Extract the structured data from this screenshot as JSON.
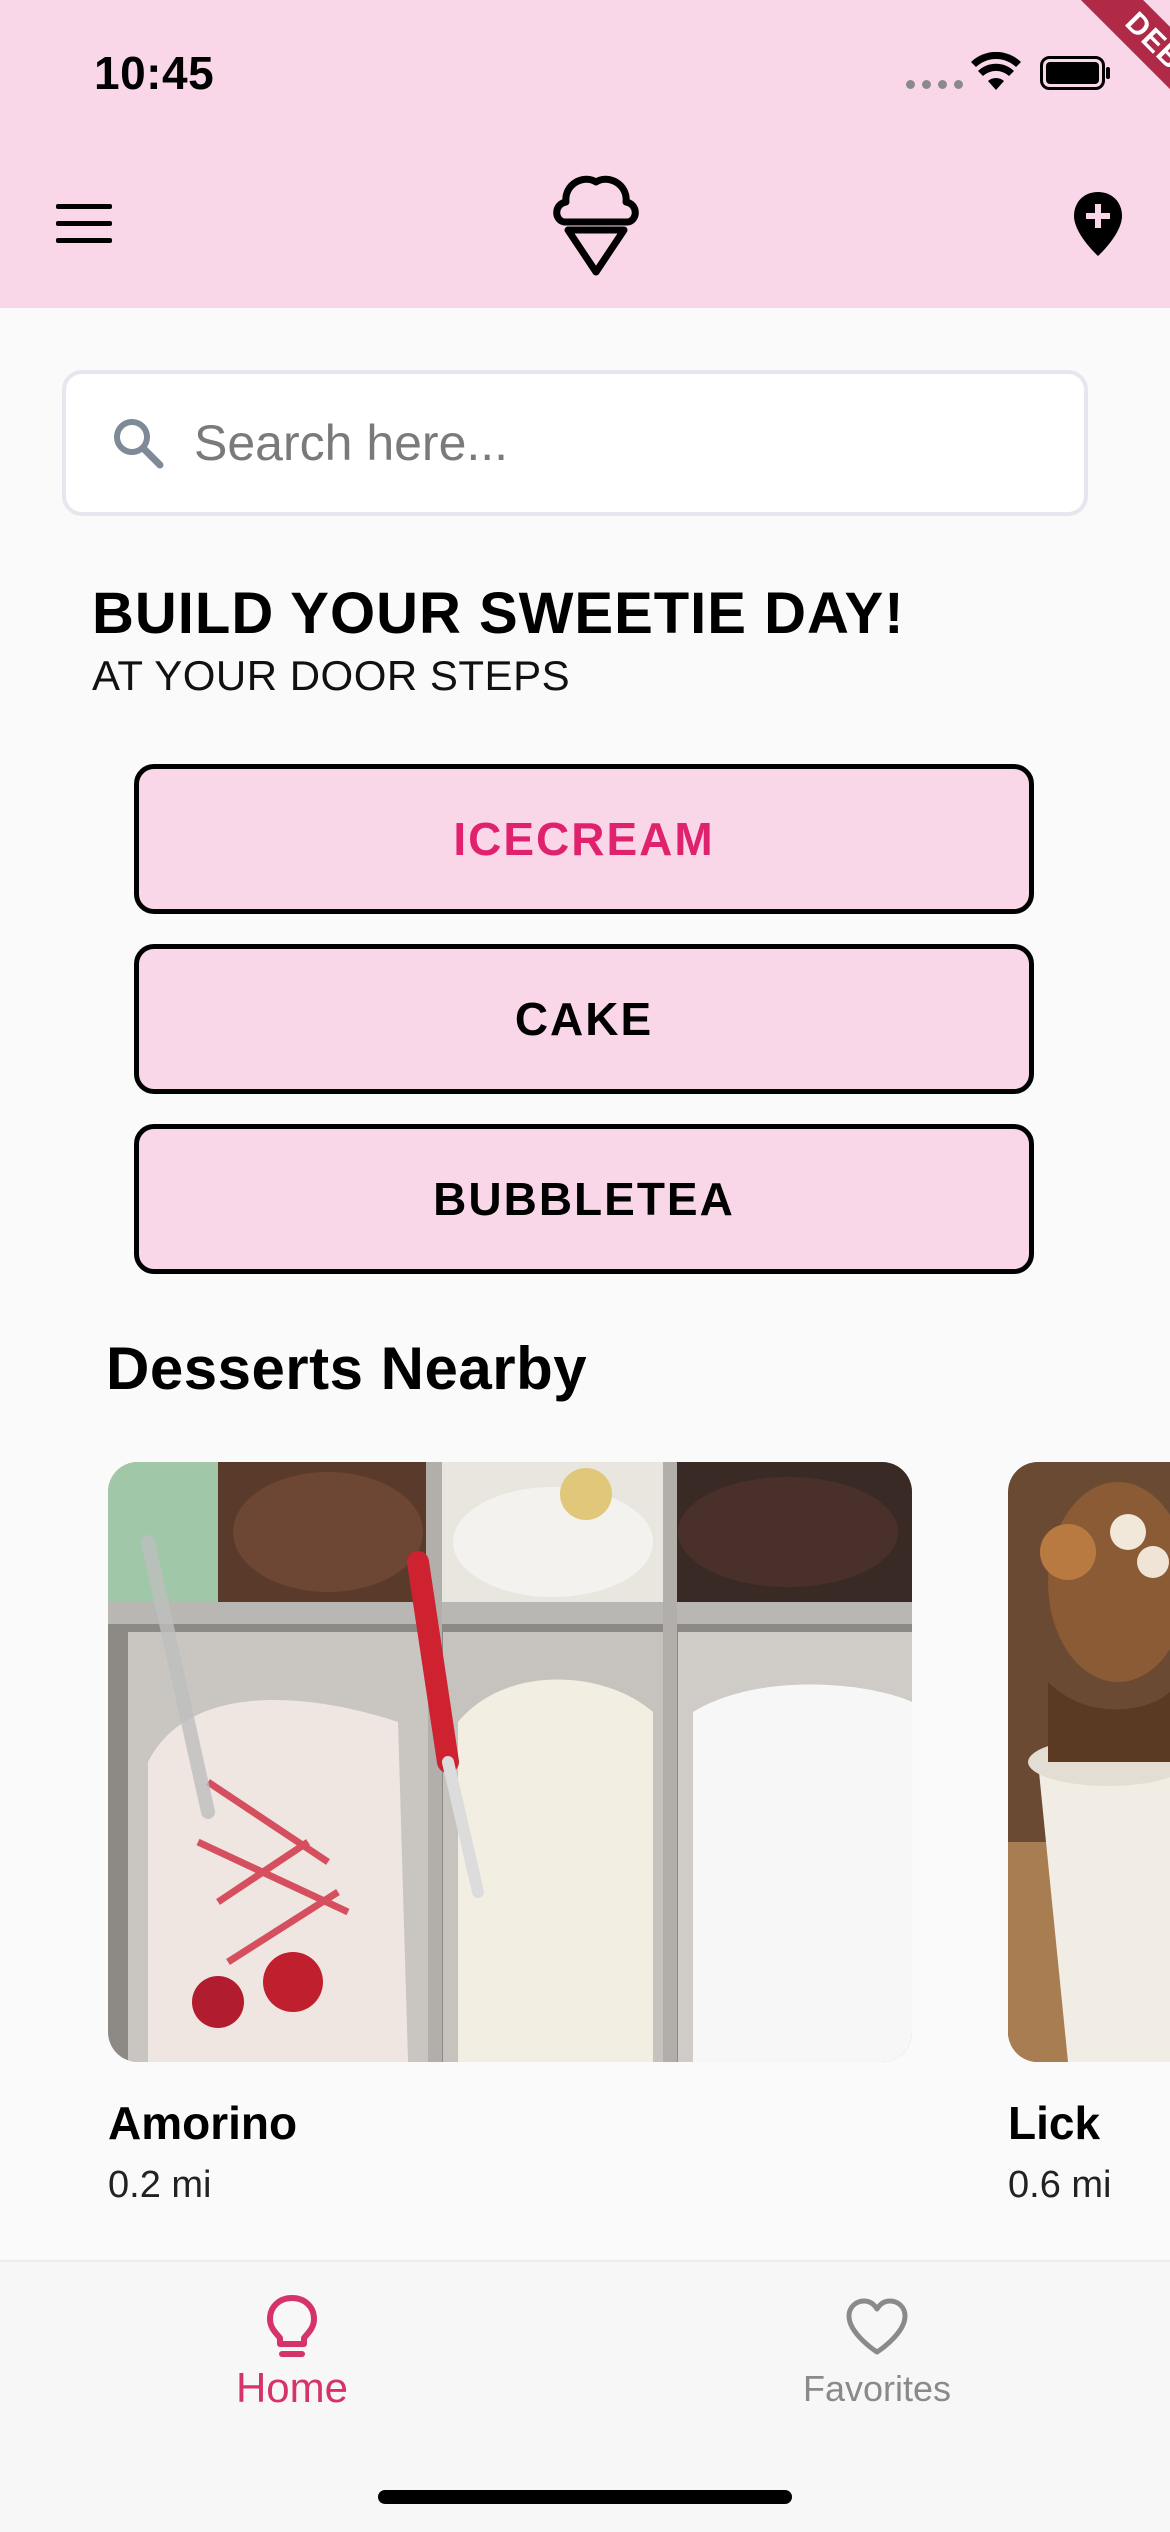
{
  "status_bar": {
    "time": "10:45"
  },
  "debug_banner": "DEBUG",
  "search": {
    "placeholder": "Search here..."
  },
  "headline": {
    "title": "BUILD YOUR SWEETIE DAY!",
    "subtitle": "AT YOUR DOOR STEPS"
  },
  "categories": [
    {
      "label": "ICECREAM",
      "selected": true
    },
    {
      "label": "CAKE",
      "selected": false
    },
    {
      "label": "BUBBLETEA",
      "selected": false
    }
  ],
  "section_title": "Desserts Nearby",
  "shops": [
    {
      "name": "Amorino",
      "distance": "0.2 mi"
    },
    {
      "name": "Lick",
      "distance": "0.6 mi"
    }
  ],
  "bottom_nav": [
    {
      "label": "Home",
      "icon": "lightbulb-icon",
      "active": true
    },
    {
      "label": "Favorites",
      "icon": "heart-icon",
      "active": false
    }
  ],
  "colors": {
    "appbar": "#f9d7e9",
    "accent": "#e0226e",
    "nav_active": "#d6336c"
  }
}
